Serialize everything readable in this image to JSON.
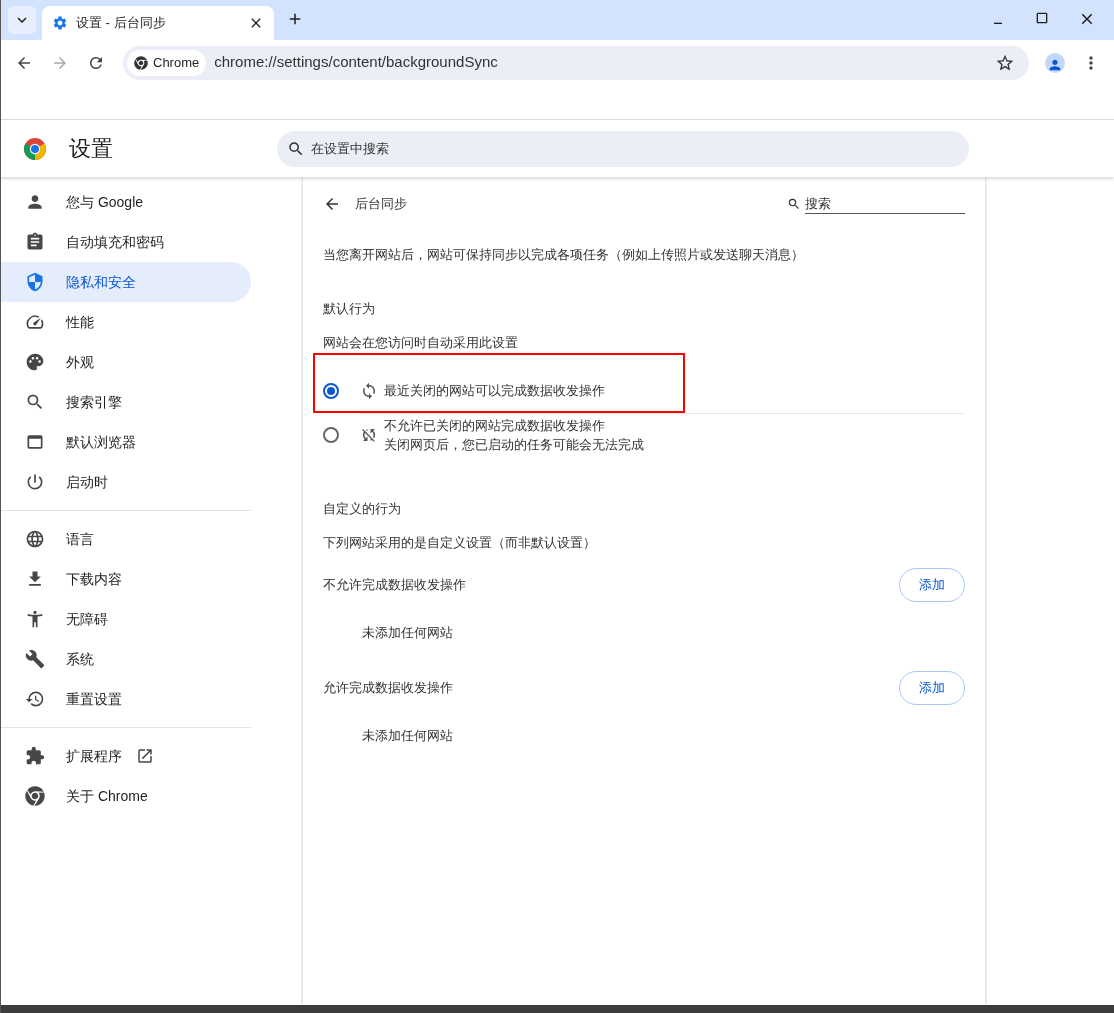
{
  "tab": {
    "title": "设置 - 后台同步",
    "selected": true
  },
  "address_bar": {
    "chip": "Chrome",
    "url": "chrome://settings/content/backgroundSync"
  },
  "settings_header": {
    "title": "设置",
    "search": {
      "placeholder": "在设置中搜索"
    }
  },
  "sidebar": {
    "sections": [
      {
        "items": [
          {
            "label": "您与 Google",
            "selected": false,
            "external": false
          },
          {
            "label": "自动填充和密码",
            "selected": false,
            "external": false
          },
          {
            "label": "隐私和安全",
            "selected": true,
            "external": false
          },
          {
            "label": "性能",
            "selected": false,
            "external": false
          },
          {
            "label": "外观",
            "selected": false,
            "external": false
          },
          {
            "label": "搜索引擎",
            "selected": false,
            "external": false
          },
          {
            "label": "默认浏览器",
            "selected": false,
            "external": false
          },
          {
            "label": "启动时",
            "selected": false,
            "external": false
          }
        ]
      },
      {
        "items": [
          {
            "label": "语言",
            "selected": false,
            "external": false
          },
          {
            "label": "下载内容",
            "selected": false,
            "external": false
          },
          {
            "label": "无障碍",
            "selected": false,
            "external": false
          },
          {
            "label": "系统",
            "selected": false,
            "external": false
          },
          {
            "label": "重置设置",
            "selected": false,
            "external": false
          }
        ]
      },
      {
        "items": [
          {
            "label": "扩展程序",
            "selected": false,
            "external": true
          },
          {
            "label": "关于 Chrome",
            "selected": false,
            "external": false
          }
        ]
      }
    ]
  },
  "page": {
    "title": "后台同步",
    "search": {
      "placeholder": "搜索"
    },
    "description": "当您离开网站后，网站可保持同步以完成各项任务（例如上传照片或发送聊天消息）",
    "default_behavior": {
      "heading": "默认行为",
      "subheading": "网站会在您访问时自动采用此设置",
      "options": [
        {
          "kind": "allow",
          "label": "最近关闭的网站可以完成数据收发操作",
          "selected": true,
          "highlighted": true
        },
        {
          "kind": "block",
          "label": "不允许已关闭的网站完成数据收发操作",
          "sublabel": "关闭网页后，您已启动的任务可能会无法完成",
          "selected": false,
          "highlighted": false
        }
      ]
    },
    "custom_behavior": {
      "heading": "自定义的行为",
      "subheading": "下列网站采用的是自定义设置（而非默认设置）",
      "lists": [
        {
          "heading": "不允许完成数据收发操作",
          "button": "添加",
          "empty": "未添加任何网站"
        },
        {
          "heading": "允许完成数据收发操作",
          "button": "添加",
          "empty": "未添加任何网站"
        }
      ]
    }
  }
}
